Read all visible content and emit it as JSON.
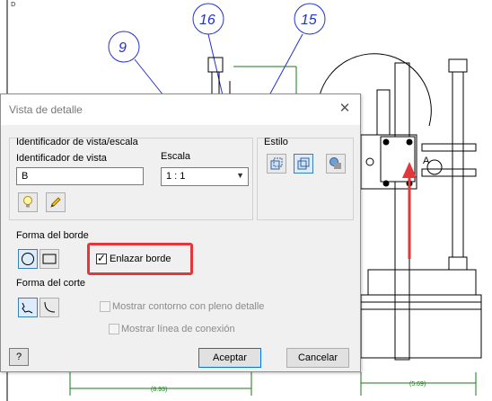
{
  "background_drawing": {
    "balloons": [
      "9",
      "16",
      "15"
    ],
    "dimensions": [
      "(8.93)",
      "(5.69)"
    ],
    "corner_label": "D"
  },
  "dialog": {
    "title": "Vista de detalle",
    "view_identifier_group": {
      "title": "Identificador de vista/escala",
      "view_id_label": "Identificador de vista",
      "view_id_value": "B",
      "scale_label": "Escala",
      "scale_value": "1 : 1"
    },
    "style_group": {
      "title": "Estilo"
    },
    "border_shape": {
      "label": "Forma del borde",
      "link_border_label": "Enlazar borde",
      "link_border_checked": true
    },
    "cut_shape": {
      "label": "Forma del corte",
      "full_detail_label": "Mostrar contorno con pleno detalle",
      "connection_line_label": "Mostrar línea de conexión"
    },
    "buttons": {
      "help": "?",
      "accept": "Aceptar",
      "cancel": "Cancelar"
    }
  },
  "colors": {
    "balloon_blue": "#2233cc",
    "dimension_green": "#1a7a1a",
    "annotation_red": "#e2383d"
  }
}
